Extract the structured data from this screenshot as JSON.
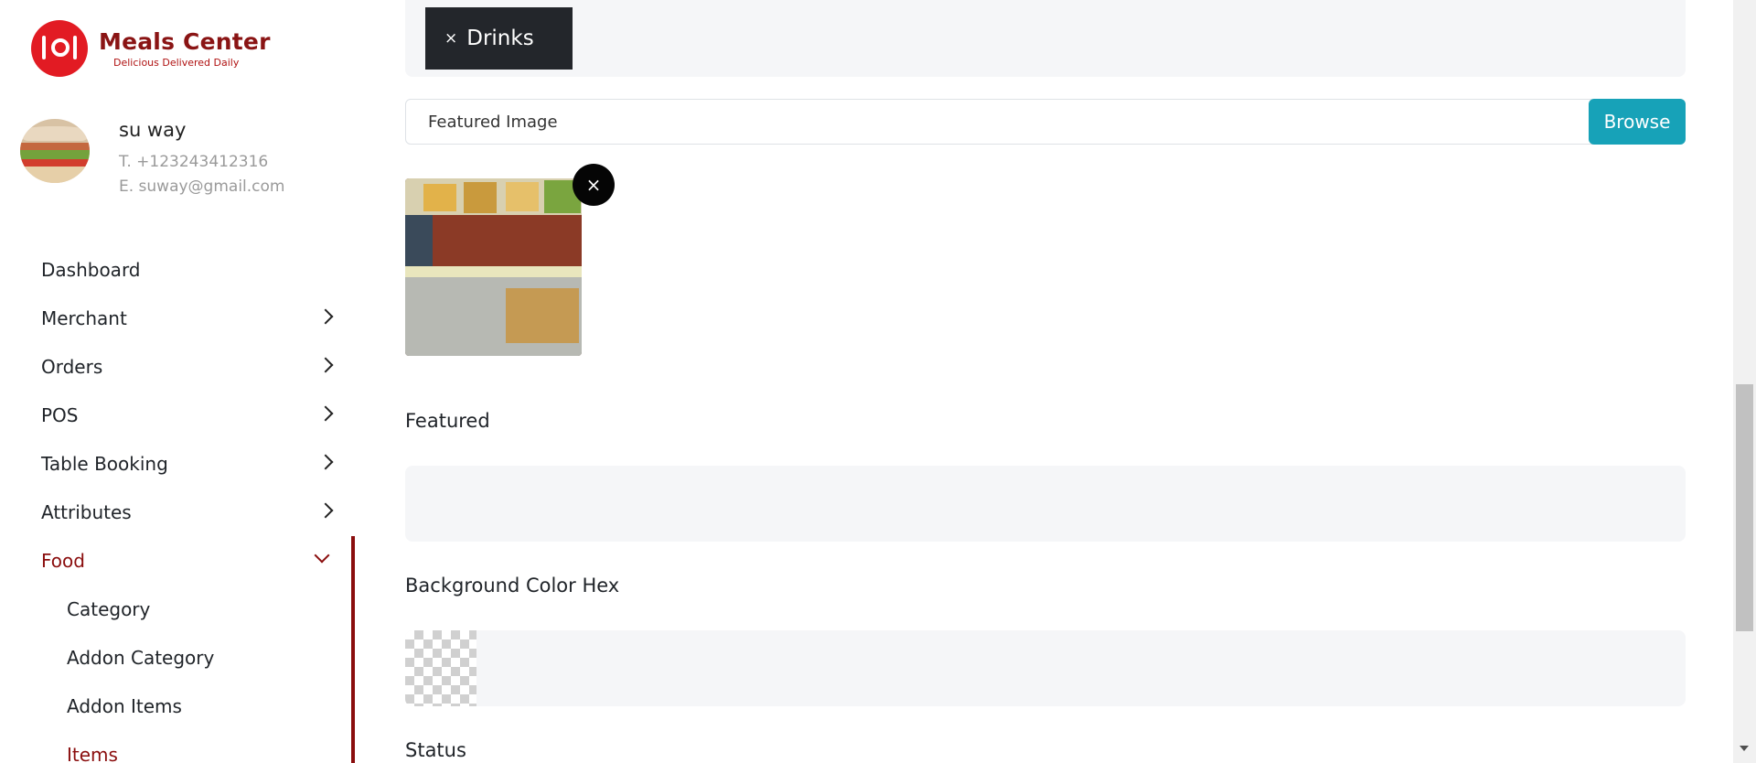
{
  "brand": {
    "title": "Meals Center",
    "tagline": "Delicious Delivered Daily",
    "color": "#8a1414",
    "badge_color": "#e21b23"
  },
  "profile": {
    "name": "su way",
    "phone": "T. +123243412316",
    "email": "E. suway@gmail.com"
  },
  "sidebar": {
    "items": [
      {
        "label": "Dashboard"
      },
      {
        "label": "Merchant"
      },
      {
        "label": "Orders"
      },
      {
        "label": "POS"
      },
      {
        "label": "Table Booking"
      },
      {
        "label": "Attributes"
      },
      {
        "label": "Food"
      }
    ],
    "food_submenu": [
      {
        "label": "Category"
      },
      {
        "label": "Addon Category"
      },
      {
        "label": "Addon Items"
      },
      {
        "label": "Items"
      }
    ],
    "active_color": "#8a0d0d"
  },
  "form": {
    "tags": [
      {
        "label": "Drinks",
        "remove_glyph": "×"
      }
    ],
    "featured_image": {
      "label": "Featured Image",
      "browse_label": "Browse",
      "browse_color": "#17a2b8",
      "remove_glyph": "×"
    },
    "featured_label": "Featured",
    "background_color_label": "Background Color Hex",
    "status_label": "Status"
  }
}
